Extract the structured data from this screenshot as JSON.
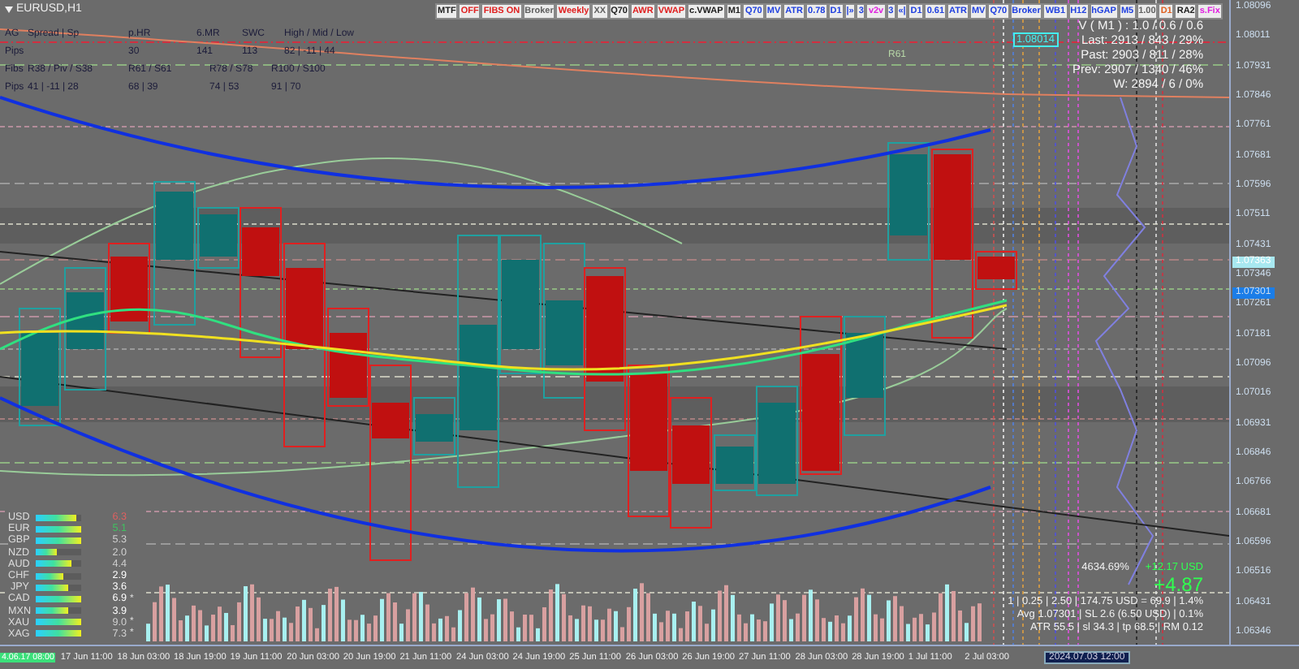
{
  "chart": {
    "symbol": "EURUSD,H1"
  },
  "toolbar": [
    {
      "label": "MTF",
      "color": "#202020"
    },
    {
      "label": "OFF",
      "color": "#e02020"
    },
    {
      "label": "FIBS ON",
      "color": "#e02020"
    },
    {
      "label": "Broker",
      "color": "#606060"
    },
    {
      "label": "Weekly",
      "color": "#e02020"
    },
    {
      "label": "XX",
      "color": "#606060"
    },
    {
      "label": "Q70",
      "color": "#202020"
    },
    {
      "label": "AWR",
      "color": "#e02020"
    },
    {
      "label": "VWAP",
      "color": "#e02020"
    },
    {
      "label": "c.VWAP",
      "color": "#202020"
    },
    {
      "label": "M1",
      "color": "#202020"
    },
    {
      "label": "Q70",
      "color": "#2040e0"
    },
    {
      "label": "MV",
      "color": "#2040e0"
    },
    {
      "label": "ATR",
      "color": "#2040e0"
    },
    {
      "label": "0.78",
      "color": "#2040e0"
    },
    {
      "label": "D1",
      "color": "#2040e0"
    },
    {
      "label": "|»",
      "color": "#2040e0"
    },
    {
      "label": "3",
      "color": "#2040e0"
    },
    {
      "label": "v2v",
      "color": "#e020e0"
    },
    {
      "label": "3",
      "color": "#2040e0"
    },
    {
      "label": "«|",
      "color": "#2040e0"
    },
    {
      "label": "D1",
      "color": "#2040e0"
    },
    {
      "label": "0.61",
      "color": "#2040e0"
    },
    {
      "label": "ATR",
      "color": "#2040e0"
    },
    {
      "label": "MV",
      "color": "#2040e0"
    },
    {
      "label": "Q70",
      "color": "#2040e0"
    },
    {
      "label": "Broker",
      "color": "#2040e0"
    },
    {
      "label": "WB1",
      "color": "#2040e0"
    },
    {
      "label": "H12",
      "color": "#2040e0"
    },
    {
      "label": "hGAP",
      "color": "#2040e0"
    },
    {
      "label": "M5",
      "color": "#2040e0"
    },
    {
      "label": "1.00",
      "color": "#606060"
    },
    {
      "label": "D1",
      "color": "#e06020"
    },
    {
      "label": "RA2",
      "color": "#202020"
    },
    {
      "label": "s.Fix",
      "color": "#e020e0"
    }
  ],
  "info_panel": [
    {
      "label": "AG",
      "headers": [
        "Spread | Sp",
        "p.HR",
        "6.MR",
        "SWC",
        "High / Mid / Low"
      ],
      "value_label": "Pips",
      "values": [
        "30",
        "141",
        "113",
        "82 | -11 | 44"
      ]
    },
    {
      "label": "Fibs",
      "headers": [
        "R38 / Piv / S38",
        "R61 / S61",
        "R78 / S78",
        "R100 / S100"
      ],
      "value_label": "Pips",
      "values": [
        "41 | -11 | 28",
        "68 | 39",
        "74 | 53",
        "91 | 70"
      ]
    }
  ],
  "volume_info": [
    "V ( M1 ) : 1.0 / 0.6 / 0.6",
    "Last: 2913 / 843 / 29%",
    "Past: 2903 / 811 / 28%",
    "Prev: 2907 / 1340 / 46%",
    "W: 2894 / 6 / 0%"
  ],
  "chart_labels": [
    {
      "text": "1.08014",
      "kind": "box"
    },
    {
      "text": "R61",
      "kind": "level"
    }
  ],
  "strength": [
    {
      "currency": "USD",
      "level": 0.9,
      "value": "6.3",
      "color": "#e06060"
    },
    {
      "currency": "EUR",
      "level": 1.0,
      "value": "5.1",
      "color": "#40c060"
    },
    {
      "currency": "GBP",
      "level": 1.0,
      "value": "5.3",
      "color": "#d0d0d0"
    },
    {
      "currency": "NZD",
      "level": 0.45,
      "value": "2.0",
      "color": "#d0d0d0"
    },
    {
      "currency": "AUD",
      "level": 0.8,
      "value": "4.4",
      "color": "#d0d0d0"
    },
    {
      "currency": "CHF",
      "level": 0.6,
      "value": "2.9",
      "color": "#ffffff"
    },
    {
      "currency": "JPY",
      "level": 0.7,
      "value": "3.6",
      "color": "#ffffff"
    },
    {
      "currency": "CAD",
      "level": 1.0,
      "value": "6.9",
      "color": "#ffffff",
      "marker": "*"
    },
    {
      "currency": "MXN",
      "level": 0.7,
      "value": "3.9",
      "color": "#ffffff"
    },
    {
      "currency": "XAU",
      "level": 1.0,
      "value": "9.0",
      "color": "#d0d0d0",
      "marker": "*"
    },
    {
      "currency": "XAG",
      "level": 1.0,
      "value": "7.3",
      "color": "#d0d0d0",
      "marker": "*"
    }
  ],
  "trade_stats": {
    "percent": "4634.69%",
    "profit": "+12.17 USD",
    "pips": "+4.87",
    "lines": [
      "1 | 0.25 | 2.50 | 174.75 USD = 69.9 | 1.4%",
      "Avg 1.07301 | SL 2.6 (6.50 USD) | 0.1%",
      "ATR 55.5 | sl 34.3 | tp 68.5 | RM 0.12"
    ]
  },
  "price_axis": [
    "1.08096",
    "1.08011",
    "1.07931",
    "1.07846",
    "1.07761",
    "1.07681",
    "1.07596",
    "1.07511",
    "1.07431",
    "1.07346",
    "1.07261",
    "1.07181",
    "1.07096",
    "1.07016",
    "1.06931",
    "1.06846",
    "1.06766",
    "1.06681",
    "1.06596",
    "1.06516",
    "1.06431",
    "1.06346"
  ],
  "price_tags": [
    {
      "text": "1.07363",
      "kind": "bid"
    },
    {
      "text": "1.07301",
      "kind": "avg"
    }
  ],
  "time_axis": {
    "start": "4.06.17 08:00",
    "labels": [
      "17 Jun 11:00",
      "18 Jun 03:00",
      "18 Jun 19:00",
      "19 Jun 11:00",
      "20 Jun 03:00",
      "20 Jun 19:00",
      "21 Jun 11:00",
      "24 Jun 03:00",
      "24 Jun 19:00",
      "25 Jun 11:00",
      "26 Jun 03:00",
      "26 Jun 19:00",
      "27 Jun 11:00",
      "28 Jun 03:00",
      "28 Jun 19:00",
      "1 Jul 11:00",
      "2 Jul 03:00"
    ],
    "cursor": "2024.07.03 12:00"
  }
}
